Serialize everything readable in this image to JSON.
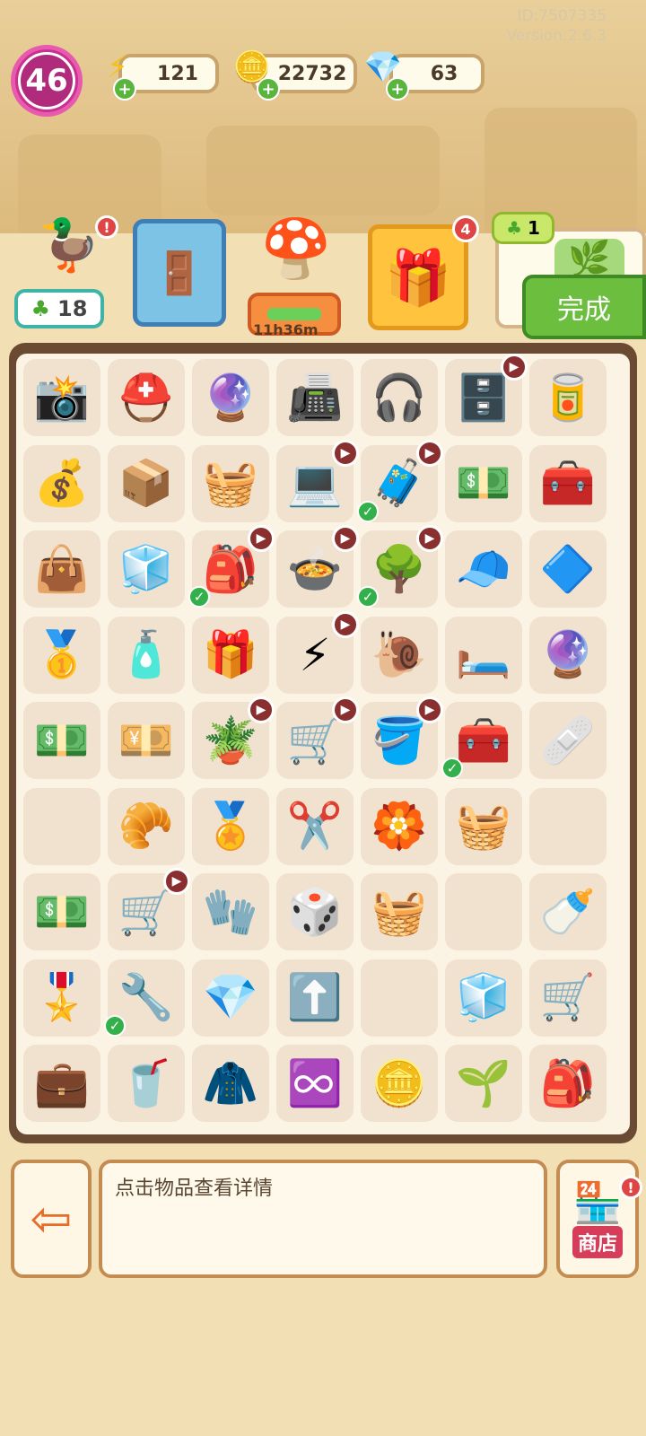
{
  "header": {
    "id_text": "ID:7507335",
    "version_text": "Version:2.6.3",
    "level": "46",
    "energy": "121",
    "coins": "22732",
    "gems": "63"
  },
  "quest_bar": {
    "duck_count": "18",
    "mushroom_timer": "11h36m",
    "gift_badge": "4",
    "reward_count": "1",
    "done_label": "完成"
  },
  "board": {
    "cells": [
      [
        "📸",
        "⛑️",
        "🔮",
        "📠",
        "🎧",
        "🗄️",
        "🥫"
      ],
      [
        "💰",
        "📦",
        "🧺",
        "💻",
        "🧳",
        "💵",
        "🧰"
      ],
      [
        "👜",
        "🧊",
        "🎒",
        "🍲",
        "🌳",
        "🧢",
        "🔷"
      ],
      [
        "🥇",
        "🧴",
        "🎁",
        "⚡",
        "🐌",
        "🛏️",
        "🔮"
      ],
      [
        "💵",
        "💴",
        "🪴",
        "🛒",
        "🪣",
        "🧰",
        "🩹"
      ],
      [
        "",
        "🥐",
        "🏅",
        "✂️",
        "🏵️",
        "🧺",
        ""
      ],
      [
        "💵",
        "🛒",
        "🧤",
        "🎲",
        "🧺",
        "",
        "🍼"
      ],
      [
        "🎖️",
        "🔧",
        "💎",
        "⬆️",
        "",
        "🧊",
        "🛒"
      ],
      [
        "💼",
        "🥤",
        "🧥",
        "♾️",
        "🪙",
        "🌱",
        "🎒"
      ]
    ]
  },
  "footer": {
    "info_text": "点击物品查看详情",
    "shop_label": "商店"
  }
}
